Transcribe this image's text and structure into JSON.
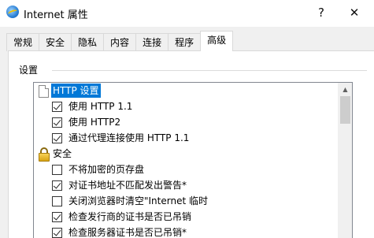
{
  "window": {
    "title": "Internet 属性",
    "help_glyph": "?",
    "close_glyph": "✕"
  },
  "tabs": [
    {
      "label": "常规",
      "active": false
    },
    {
      "label": "安全",
      "active": false
    },
    {
      "label": "隐私",
      "active": false
    },
    {
      "label": "内容",
      "active": false
    },
    {
      "label": "连接",
      "active": false
    },
    {
      "label": "程序",
      "active": false
    },
    {
      "label": "高级",
      "active": true
    }
  ],
  "settings": {
    "group_label": "设置",
    "items": [
      {
        "type": "category",
        "icon": "document-icon",
        "label": "HTTP 设置",
        "selected": true
      },
      {
        "type": "checkbox",
        "label": "使用 HTTP 1.1",
        "checked": true
      },
      {
        "type": "checkbox",
        "label": "使用 HTTP2",
        "checked": true
      },
      {
        "type": "checkbox",
        "label": "通过代理连接使用 HTTP 1.1",
        "checked": true
      },
      {
        "type": "category",
        "icon": "lock-icon",
        "label": "安全",
        "selected": false
      },
      {
        "type": "checkbox",
        "label": "不将加密的页存盘",
        "checked": false
      },
      {
        "type": "checkbox",
        "label": "对证书地址不匹配发出警告*",
        "checked": true
      },
      {
        "type": "checkbox",
        "label": "关闭浏览器时清空\"Internet 临时",
        "checked": false
      },
      {
        "type": "checkbox",
        "label": "检查发行商的证书是否已吊销",
        "checked": true
      },
      {
        "type": "checkbox",
        "label": "检查服务器证书是否已吊销*",
        "checked": true
      }
    ]
  },
  "scrollbar": {
    "up_glyph": "▲"
  }
}
